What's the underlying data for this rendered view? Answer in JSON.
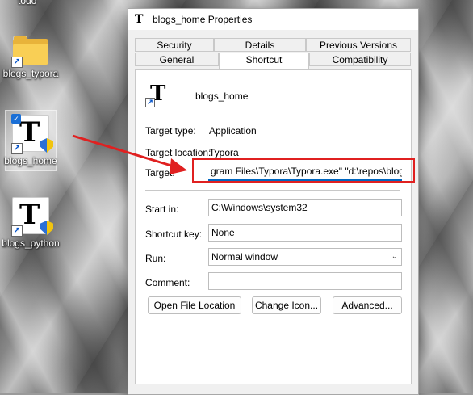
{
  "desktop": {
    "top_label": "todo",
    "icons": [
      {
        "label": "blogs_typora"
      },
      {
        "label": "blogs_home"
      },
      {
        "label": "blogs_python"
      }
    ]
  },
  "dialog": {
    "title": "blogs_home Properties",
    "tabs_row1": [
      "Security",
      "Details",
      "Previous Versions"
    ],
    "tabs_row2": [
      "General",
      "Shortcut",
      "Compatibility"
    ],
    "active_tab": "Shortcut",
    "shortcut_name": "blogs_home",
    "target_type_label": "Target type:",
    "target_type_value": "Application",
    "target_location_label": "Target location:",
    "target_location_value": "Typora",
    "target_label": "Target:",
    "target_value": "gram Files\\Typora\\Typora.exe\" \"d:\\repos\\blogs\"",
    "start_in_label": "Start in:",
    "start_in_value": "C:\\Windows\\system32",
    "shortcut_key_label": "Shortcut key:",
    "shortcut_key_value": "None",
    "run_label": "Run:",
    "run_value": "Normal window",
    "comment_label": "Comment:",
    "comment_value": "",
    "buttons": {
      "open_location": "Open File Location",
      "change_icon": "Change Icon...",
      "advanced": "Advanced..."
    }
  },
  "colors": {
    "highlight_red": "#e02020",
    "accent": "#0067c0"
  }
}
